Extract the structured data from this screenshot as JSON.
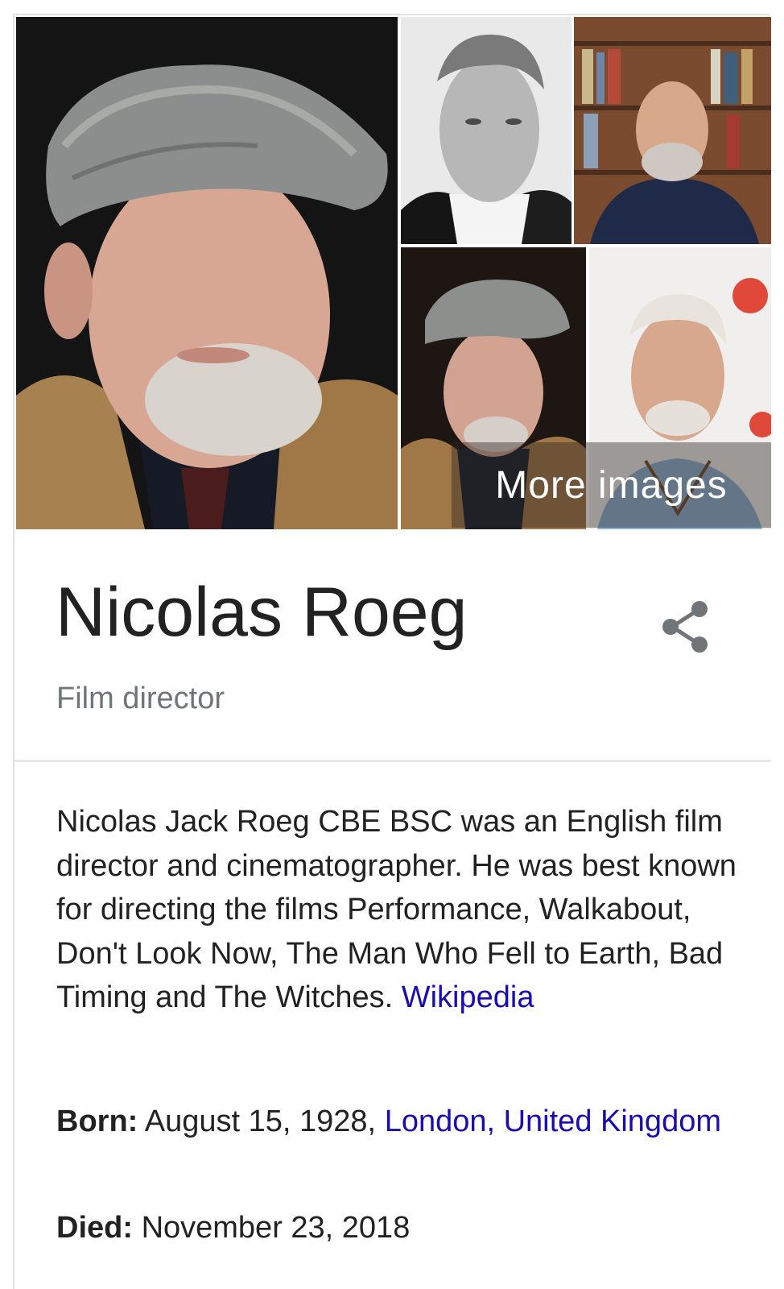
{
  "gallery": {
    "more_images_label": "More images"
  },
  "entity": {
    "name": "Nicolas Roeg",
    "type": "Film director"
  },
  "description": {
    "text": "Nicolas Jack Roeg CBE BSC was an English film director and cinematographer. He was best known for directing the films Performance, Walkabout, Don't Look Now, The Man Who Fell to Earth, Bad Timing and The Witches.",
    "source_link": "Wikipedia"
  },
  "facts": {
    "born": {
      "label": "Born:",
      "date": "August 15, 1928,",
      "place_link": "London, United Kingdom"
    },
    "died": {
      "label": "Died:",
      "date": "November 23, 2018"
    }
  },
  "colors": {
    "link": "#1a0dab",
    "title_text": "#222222",
    "secondary_text": "#70757a",
    "divider": "#e8e8e8"
  },
  "icons": {
    "share": "share-icon"
  }
}
